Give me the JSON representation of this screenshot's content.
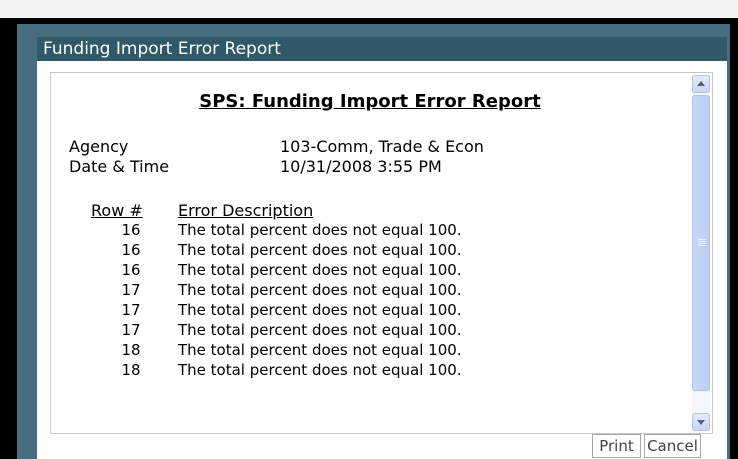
{
  "dialog": {
    "title": "Funding Import Error Report"
  },
  "report": {
    "heading": "SPS: Funding Import Error Report",
    "agency_label": "Agency",
    "agency_value": "103-Comm, Trade & Econ",
    "datetime_label": "Date & Time",
    "datetime_value": "10/31/2008 3:55 PM",
    "columns": {
      "row": "Row #",
      "description": "Error Description"
    },
    "rows": [
      {
        "row": "16",
        "description": "The total percent does not equal 100."
      },
      {
        "row": "16",
        "description": "The total percent does not equal 100."
      },
      {
        "row": "16",
        "description": "The total percent does not equal 100."
      },
      {
        "row": "17",
        "description": "The total percent does not equal 100."
      },
      {
        "row": "17",
        "description": "The total percent does not equal 100."
      },
      {
        "row": "17",
        "description": "The total percent does not equal 100."
      },
      {
        "row": "18",
        "description": "The total percent does not equal 100."
      },
      {
        "row": "18",
        "description": "The total percent does not equal 100."
      }
    ]
  },
  "buttons": {
    "print": "Print",
    "cancel": "Cancel"
  },
  "icons": {
    "scroll_up": "chevron-up-icon",
    "scroll_down": "chevron-down-icon"
  }
}
